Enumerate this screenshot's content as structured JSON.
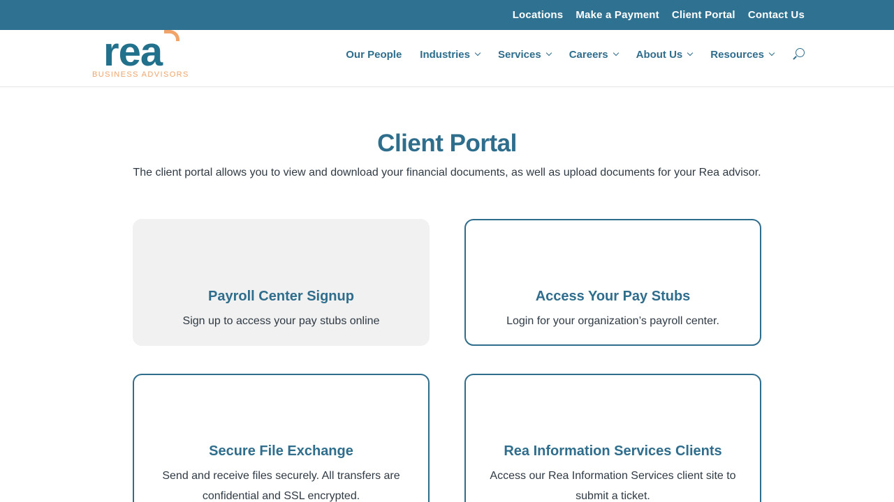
{
  "topbar": {
    "links": [
      "Locations",
      "Make a Payment",
      "Client Portal",
      "Contact Us"
    ]
  },
  "logo": {
    "wordmark": "rea",
    "subtitle": "BUSINESS ADVISORS"
  },
  "nav": {
    "items": [
      "Our People",
      "Industries",
      "Services",
      "Careers",
      "About Us",
      "Resources"
    ],
    "search_icon": "search-icon"
  },
  "main": {
    "title": "Client Portal",
    "intro": "The client portal allows you to view and download your financial documents, as well as upload documents for your Rea advisor."
  },
  "cards": [
    {
      "title": "Payroll Center Signup",
      "description": "Sign up to access your pay stubs online"
    },
    {
      "title": "Access Your Pay Stubs",
      "description": "Login for your organization’s payroll center."
    },
    {
      "title": "Secure File Exchange",
      "description": "Send and receive files securely. All transfers are confidential and SSL encrypted."
    },
    {
      "title": "Rea Information Services Clients",
      "description": "Access our Rea Information Services client site to submit a ticket."
    }
  ],
  "colors": {
    "brand_blue": "#2f7191",
    "heading_blue": "#2f6d8c",
    "accent_orange": "#f0a46a",
    "card_fill": "#f1f1f1"
  }
}
